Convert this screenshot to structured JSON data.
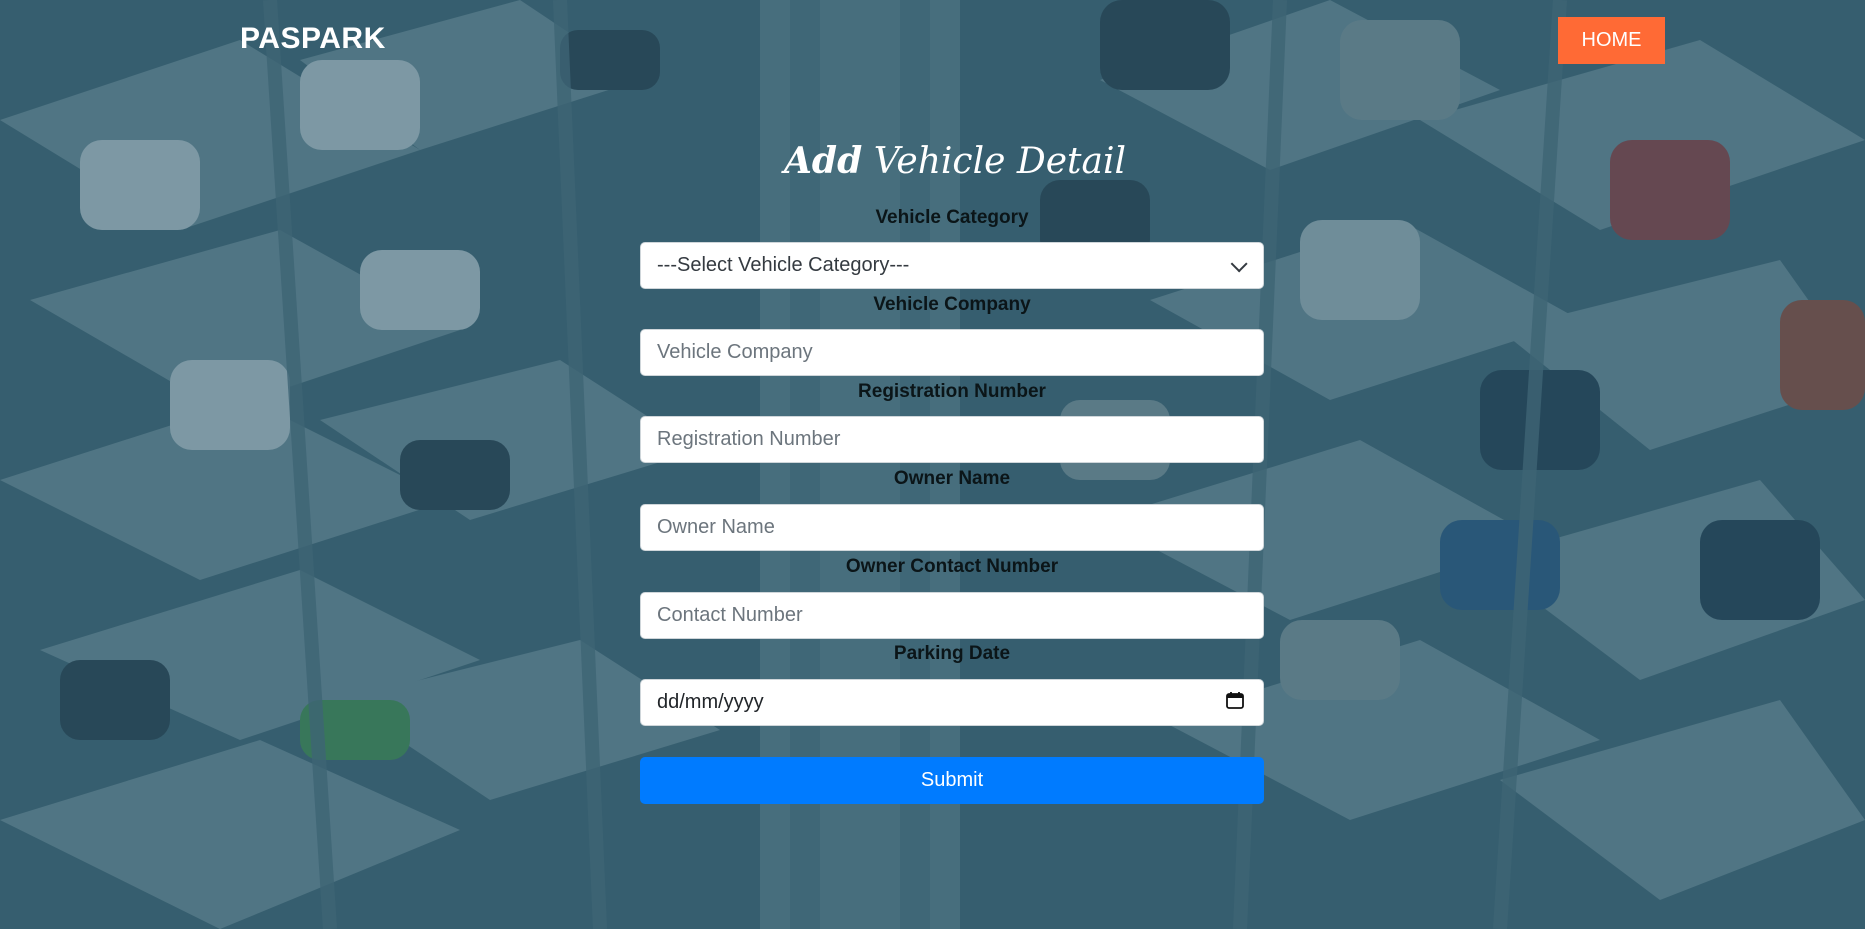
{
  "header": {
    "brand": "PASPARK",
    "home_label": "HOME"
  },
  "form": {
    "title_bold": "Add",
    "title_rest": "Vehicle Detail",
    "vehicle_category": {
      "label": "Vehicle Category",
      "selected": "---Select Vehicle Category---"
    },
    "vehicle_company": {
      "label": "Vehicle Company",
      "placeholder": "Vehicle Company"
    },
    "registration_number": {
      "label": "Registration Number",
      "placeholder": "Registration Number"
    },
    "owner_name": {
      "label": "Owner Name",
      "placeholder": "Owner Name"
    },
    "owner_contact": {
      "label": "Owner Contact Number",
      "placeholder": "Contact Number"
    },
    "parking_date": {
      "label": "Parking Date",
      "placeholder": "dd/mm/yyyy"
    },
    "submit_label": "Submit"
  },
  "colors": {
    "home_button": "#ff6a35",
    "submit_button": "#007bff",
    "overlay": "#2b5a6e"
  },
  "icons": {
    "date_picker": "calendar-icon",
    "select_arrow": "chevron-down-icon"
  }
}
